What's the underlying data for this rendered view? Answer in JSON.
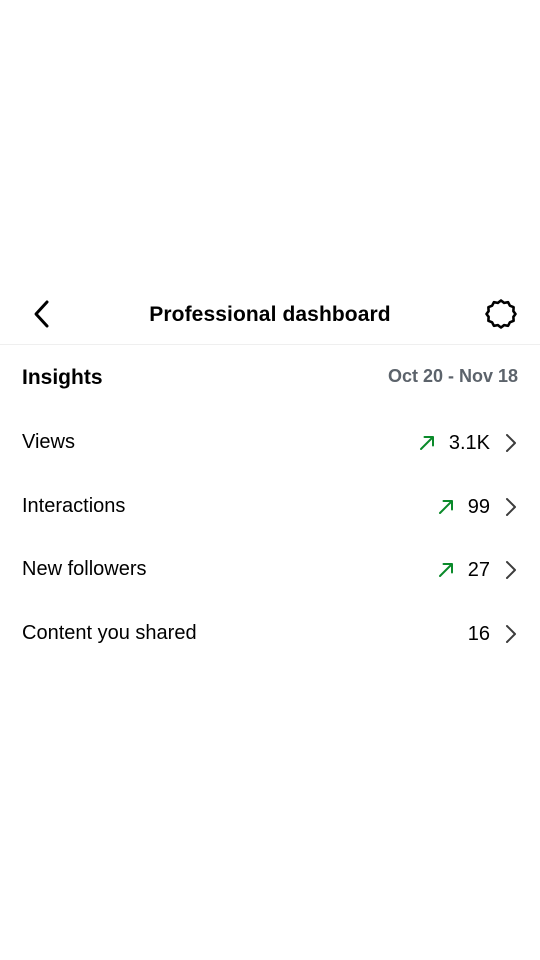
{
  "header": {
    "title": "Professional dashboard",
    "back_icon": "back-arrow-icon",
    "settings_icon": "gear-icon"
  },
  "insights": {
    "title": "Insights",
    "date_range": "Oct 20 - Nov 18"
  },
  "metrics": [
    {
      "label": "Views",
      "value": "3.1K",
      "trend": "up"
    },
    {
      "label": "Interactions",
      "value": "99",
      "trend": "up"
    },
    {
      "label": "New followers",
      "value": "27",
      "trend": "up"
    },
    {
      "label": "Content you shared",
      "value": "16",
      "trend": "none"
    }
  ],
  "colors": {
    "trend_up": "#0a8a2a",
    "date_range": "#5c636b",
    "chevron": "#3c3c3c",
    "divider": "#efefef"
  }
}
